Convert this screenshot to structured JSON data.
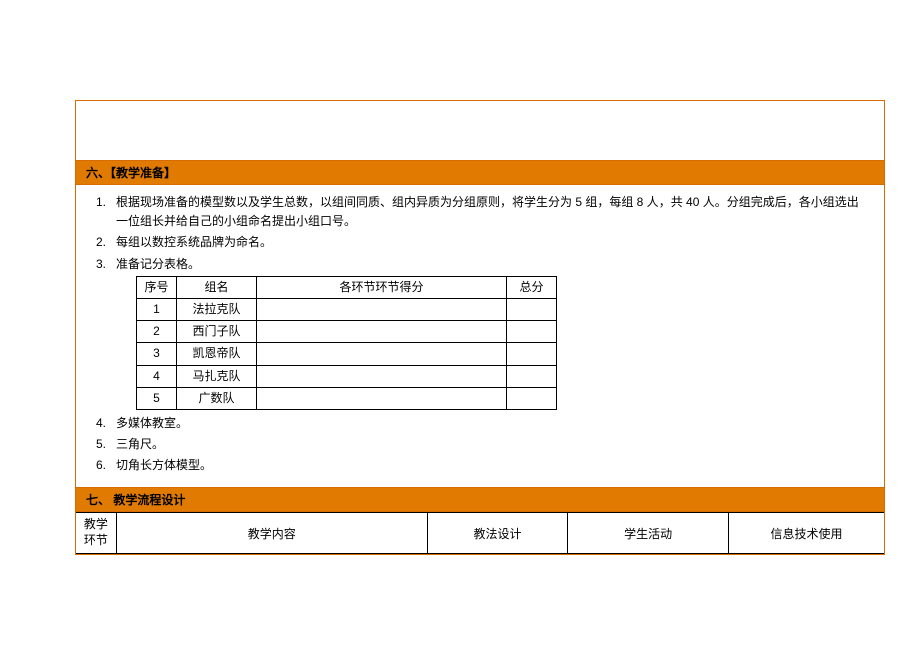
{
  "section6": {
    "header": "六、【教学准备】",
    "items": [
      {
        "num": "1.",
        "text": "根据现场准备的模型数以及学生总数，以组间同质、组内异质为分组原则，将学生分为 5 组，每组 8 人，共 40 人。分组完成后，各小组选出一位组长并给自己的小组命名提出小组口号。"
      },
      {
        "num": "2.",
        "text": "每组以数控系统品牌为命名。"
      },
      {
        "num": "3.",
        "text": "准备记分表格。"
      },
      {
        "num": "4.",
        "text": "多媒体教室。"
      },
      {
        "num": "5.",
        "text": "三角尺。"
      },
      {
        "num": "6.",
        "text": "切角长方体模型。"
      }
    ],
    "scoreTable": {
      "headers": [
        "序号",
        "组名",
        "各环节环节得分",
        "总分"
      ],
      "rows": [
        {
          "no": "1",
          "name": "法拉克队",
          "score": "",
          "total": ""
        },
        {
          "no": "2",
          "name": "西门子队",
          "score": "",
          "total": ""
        },
        {
          "no": "3",
          "name": "凯恩帝队",
          "score": "",
          "total": ""
        },
        {
          "no": "4",
          "name": "马扎克队",
          "score": "",
          "total": ""
        },
        {
          "no": "5",
          "name": "广数队",
          "score": "",
          "total": ""
        }
      ]
    }
  },
  "section7": {
    "header": "七、 教学流程设计",
    "columns": {
      "stage": "教学环节",
      "content": "教学内容",
      "method": "教法设计",
      "activity": "学生活动",
      "tech": "信息技术使用"
    }
  }
}
